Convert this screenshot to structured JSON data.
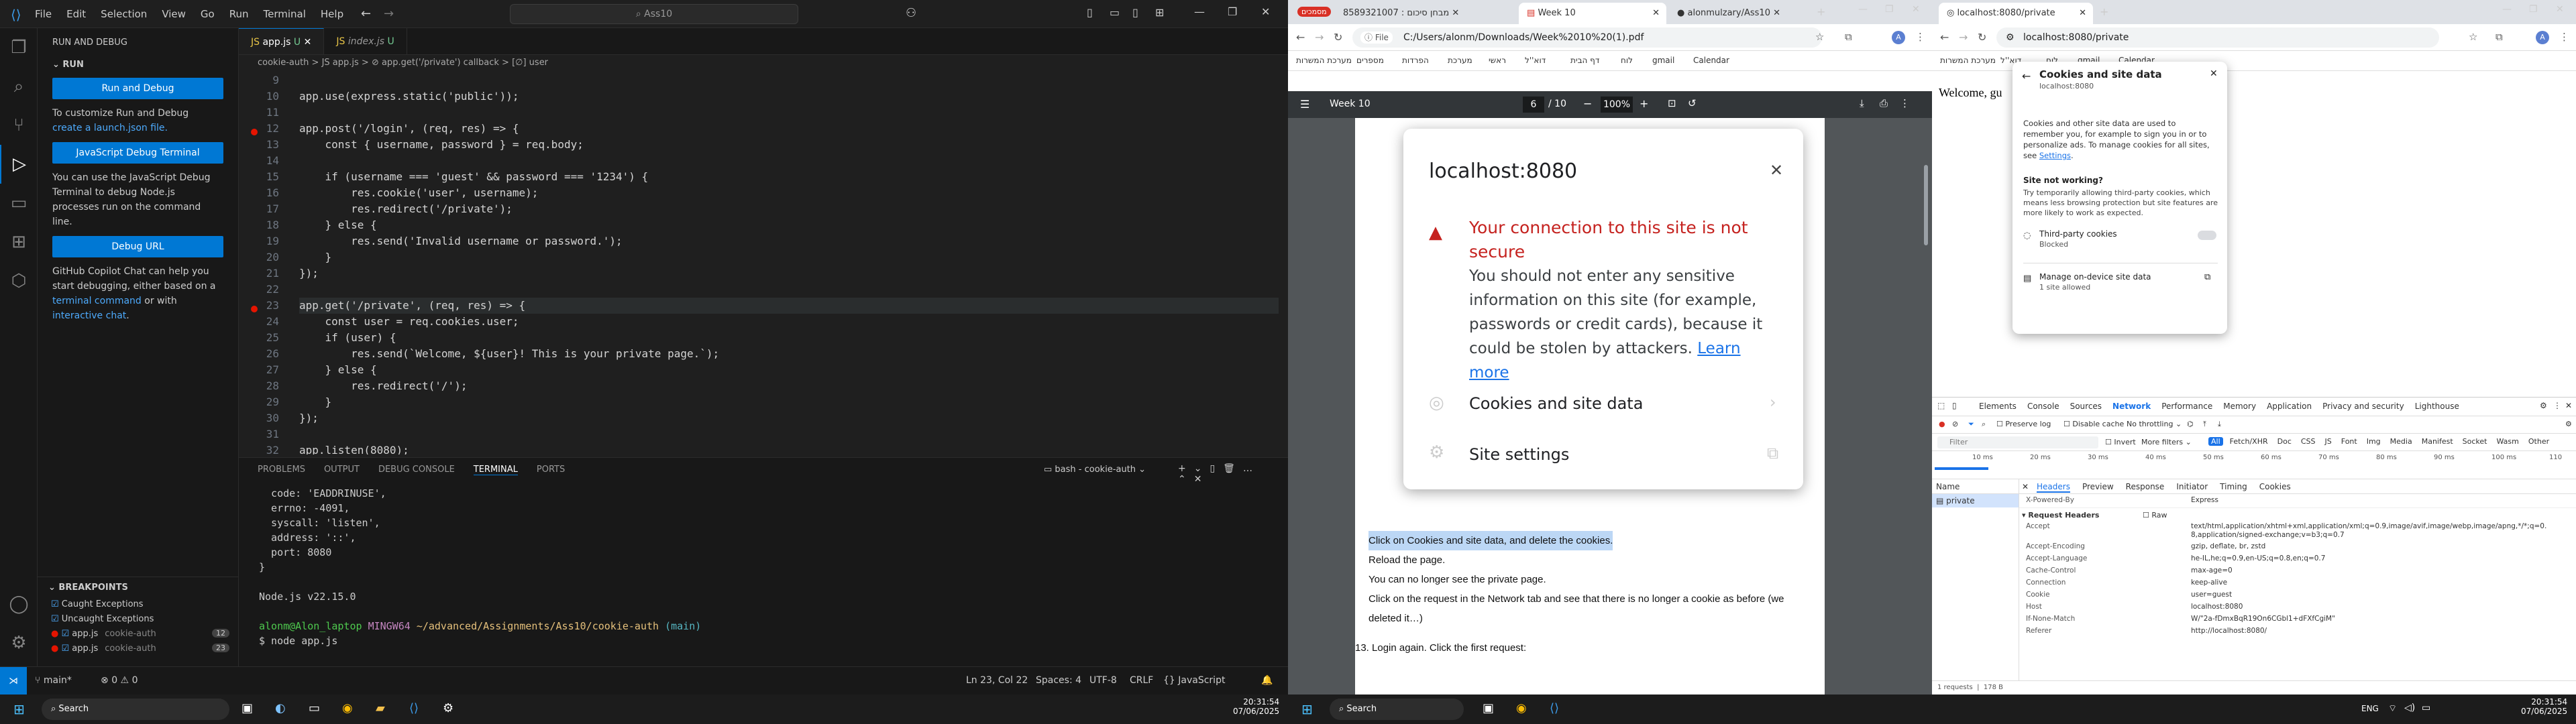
{
  "vscode": {
    "menu": [
      "File",
      "Edit",
      "Selection",
      "View",
      "Go",
      "Run",
      "Terminal",
      "Help"
    ],
    "search": "Ass10",
    "sidebar": {
      "title": "RUN AND DEBUG",
      "section": "RUN",
      "run_debug_btn": "Run and Debug",
      "customize_text": "To customize Run and Debug",
      "create_link": "create a launch.json file.",
      "js_terminal_btn": "JavaScript Debug Terminal",
      "js_terminal_text": "You can use the JavaScript Debug Terminal to debug Node.js processes run on the command line.",
      "debug_url_btn": "Debug URL",
      "copilot_text": "GitHub Copilot Chat can help you start debugging, either based on a",
      "terminal_link": "terminal command",
      "or_with": "or with",
      "interactive_link": "interactive chat",
      "breakpoints_title": "BREAKPOINTS",
      "bp_items": [
        {
          "label": "Caught Exceptions",
          "file": "",
          "line": ""
        },
        {
          "label": "Uncaught Exceptions",
          "file": "",
          "line": ""
        },
        {
          "label": "app.js",
          "file": "cookie-auth",
          "line": "12"
        },
        {
          "label": "app.js",
          "file": "cookie-auth",
          "line": "23"
        }
      ]
    },
    "tabs": [
      {
        "label": "app.js",
        "mark": "U"
      },
      {
        "label": "index.js",
        "mark": "U"
      }
    ],
    "breadcrumb": "cookie-auth > JS app.js > ⊘ app.get('/private') callback > [∅] user",
    "code_lines": [
      {
        "n": "9",
        "t": ""
      },
      {
        "n": "10",
        "t": "app.use(express.static('public'));"
      },
      {
        "n": "11",
        "t": ""
      },
      {
        "n": "12",
        "t": "app.post('/login', (req, res) => {"
      },
      {
        "n": "13",
        "t": "    const { username, password } = req.body;"
      },
      {
        "n": "14",
        "t": ""
      },
      {
        "n": "15",
        "t": "    if (username === 'guest' && password === '1234') {"
      },
      {
        "n": "16",
        "t": "        res.cookie('user', username);"
      },
      {
        "n": "17",
        "t": "        res.redirect('/private');"
      },
      {
        "n": "18",
        "t": "    } else {"
      },
      {
        "n": "19",
        "t": "        res.send('Invalid username or password.');"
      },
      {
        "n": "20",
        "t": "    }"
      },
      {
        "n": "21",
        "t": "});"
      },
      {
        "n": "22",
        "t": ""
      },
      {
        "n": "23",
        "t": "app.get('/private', (req, res) => {"
      },
      {
        "n": "24",
        "t": "    const user = req.cookies.user;"
      },
      {
        "n": "25",
        "t": "    if (user) {"
      },
      {
        "n": "26",
        "t": "        res.send(`Welcome, ${user}! This is your private page.`);"
      },
      {
        "n": "27",
        "t": "    } else {"
      },
      {
        "n": "28",
        "t": "        res.redirect('/');"
      },
      {
        "n": "29",
        "t": "    }"
      },
      {
        "n": "30",
        "t": "});"
      },
      {
        "n": "31",
        "t": ""
      },
      {
        "n": "32",
        "t": "app.listen(8080);"
      }
    ],
    "panel_tabs": [
      "PROBLEMS",
      "OUTPUT",
      "DEBUG CONSOLE",
      "TERMINAL",
      "PORTS"
    ],
    "terminal_name": "bash - cookie-auth",
    "terminal_lines": [
      "  code: 'EADDRINUSE',",
      "  errno: -4091,",
      "  syscall: 'listen',",
      "  address: '::',",
      "  port: 8080",
      "}",
      "",
      "Node.js v22.15.0",
      ""
    ],
    "prompt_user": "alonm@Alon_laptop",
    "prompt_host": "MINGW64",
    "prompt_path": "~/advanced/Assignments/Ass10/cookie-auth",
    "prompt_branch": "(main)",
    "command": "$ node app.js",
    "status": {
      "branch": "main*",
      "errors": "0",
      "warnings": "0",
      "cursor": "Ln 23, Col 22",
      "spaces": "Spaces: 4",
      "encoding": "UTF-8",
      "eol": "CRLF",
      "lang": "JavaScript"
    }
  },
  "chrome1": {
    "tabs": [
      {
        "label": "8589321007 : מבחן סיכום"
      },
      {
        "label": "Week 10"
      },
      {
        "label": "alonmulzary/Ass10"
      }
    ],
    "url": "C:/Users/alonm/Downloads/Week%2010%20(1).pdf",
    "file_label": "File",
    "bookmarks": [
      "מערכת המשרות",
      "מספרים",
      "הפרדות",
      "מערכת",
      "ראשי",
      "דוא''ל",
      "דף הבית",
      "לוח",
      "gmail",
      "Calendar"
    ],
    "pdf_title": "Week 10",
    "page": "6",
    "total": "/ 10",
    "zoom": "100%",
    "popup": {
      "host": "localhost:8080",
      "warning_title": "Your connection to this site is not secure",
      "warning_body": "You should not enter any sensitive information on this site (for example, passwords or credit cards), because it could be stolen by attackers.",
      "learn_more": "Learn more",
      "cookies": "Cookies and site data",
      "settings": "Site settings"
    },
    "pdf_lines": [
      "Click on Cookies and site data, and delete the cookies.",
      "Reload the page.",
      "You can no longer see the private page.",
      "Click on the request in the Network tab and see that there is no longer a cookie as before (we deleted it…)"
    ],
    "step13": "13.  Login again. Click the first request:"
  },
  "chrome2": {
    "tab": "localhost:8080/private",
    "url": "localhost:8080/private",
    "page_text": "Welcome, gu",
    "bookmarks": [
      "מערכת המשרות",
      "דוא''ל",
      "לוח",
      "gmail",
      "Calendar"
    ],
    "cookiepop": {
      "title": "Cookies and site data",
      "host": "localhost:8080",
      "desc": "Cookies and other site data are used to remember you, for example to sign you in or to personalize ads. To manage cookies for all sites, see",
      "settings_link": "Settings",
      "not_working": "Site not working?",
      "not_working_desc": "Try temporarily allowing third-party cookies, which means less browsing protection but site features are more likely to work as expected.",
      "third_party": "Third-party cookies",
      "blocked": "Blocked",
      "manage": "Manage on-device site data",
      "allowed": "1 site allowed"
    },
    "devtools_tabs": [
      "Elements",
      "Console",
      "Sources",
      "Network",
      "Performance",
      "Memory",
      "Application",
      "Privacy and security",
      "Lighthouse"
    ],
    "filters": [
      "All",
      "Fetch/XHR",
      "Doc",
      "CSS",
      "JS",
      "Font",
      "Img",
      "Media",
      "Manifest",
      "Socket",
      "Wasm",
      "Other"
    ],
    "throttling": "No throttling",
    "filter_placeholder": "Filter",
    "invert": "Invert",
    "more_filters": "More filters",
    "preserve": "Preserve log",
    "disable_cache": "Disable cache",
    "timeline": [
      "10 ms",
      "20 ms",
      "30 ms",
      "40 ms",
      "50 ms",
      "60 ms",
      "70 ms",
      "80 ms",
      "90 ms",
      "100 ms",
      "110"
    ],
    "name_header": "Name",
    "request": "private",
    "detail_tabs": [
      "Headers",
      "Preview",
      "Response",
      "Initiator",
      "Timing",
      "Cookies"
    ],
    "req_headers_title": "▾ Request Headers",
    "raw": "Raw",
    "x_powered": "X-Powered-By",
    "x_powered_val": "Express",
    "headers": [
      {
        "k": "Accept",
        "v": "text/html,application/xhtml+xml,application/xml;q=0.9,image/avif,image/webp,image/apng,*/*;q=0.8,application/signed-exchange;v=b3;q=0.7"
      },
      {
        "k": "Accept-Encoding",
        "v": "gzip, deflate, br, zstd"
      },
      {
        "k": "Accept-Language",
        "v": "he-IL,he;q=0.9,en-US;q=0.8,en;q=0.7"
      },
      {
        "k": "Cache-Control",
        "v": "max-age=0"
      },
      {
        "k": "Connection",
        "v": "keep-alive"
      },
      {
        "k": "Cookie",
        "v": "user=guest"
      },
      {
        "k": "Host",
        "v": "localhost:8080"
      },
      {
        "k": "If-None-Match",
        "v": "W/\"2a-fDmxBqR19On6CGbl1+dFXfCgiM\""
      },
      {
        "k": "Referer",
        "v": "http://localhost:8080/"
      }
    ],
    "requests_count": "1 requests",
    "transferred": "178 B"
  },
  "taskbar": {
    "search": "Search",
    "time1": "20:31:54",
    "date1": "07/06/2025",
    "time2": "20:31:54",
    "date2": "07/06/2025",
    "lang": "ENG"
  }
}
